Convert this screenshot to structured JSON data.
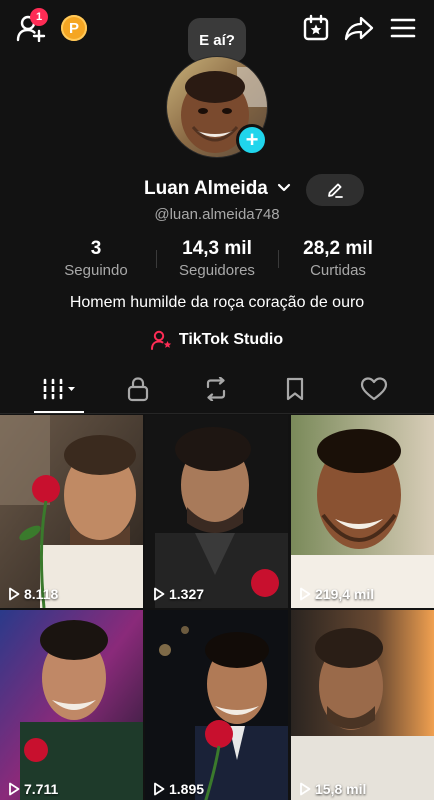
{
  "header": {
    "notification_count": "1",
    "points_label": "P"
  },
  "profile": {
    "bubble_text": "E aí?",
    "name": "Luan Almeida",
    "handle": "@luan.almeida748",
    "bio": "Homem humilde da roça coração de ouro",
    "studio_label": "TikTok Studio"
  },
  "stats": [
    {
      "value": "3",
      "label": "Seguindo"
    },
    {
      "value": "14,3 mil",
      "label": "Seguidores"
    },
    {
      "value": "28,2 mil",
      "label": "Curtidas"
    }
  ],
  "videos": [
    {
      "views": "8.118"
    },
    {
      "views": "1.327"
    },
    {
      "views": "219,4 mil"
    },
    {
      "views": "7.711"
    },
    {
      "views": "1.895"
    },
    {
      "views": "15,8 mil"
    }
  ],
  "colors": {
    "background": "#121212",
    "accent_cyan": "#20d5ec",
    "badge_red": "#fe2c55",
    "coin_orange": "#f5a623"
  },
  "icons": {
    "add_friend": "person-plus-icon",
    "calendar": "calendar-star-icon",
    "share": "share-arrow-icon",
    "menu": "hamburger-menu-icon",
    "tabs": [
      "grid-icon",
      "lock-icon",
      "repost-icon",
      "bookmark-icon",
      "heart-icon"
    ]
  }
}
